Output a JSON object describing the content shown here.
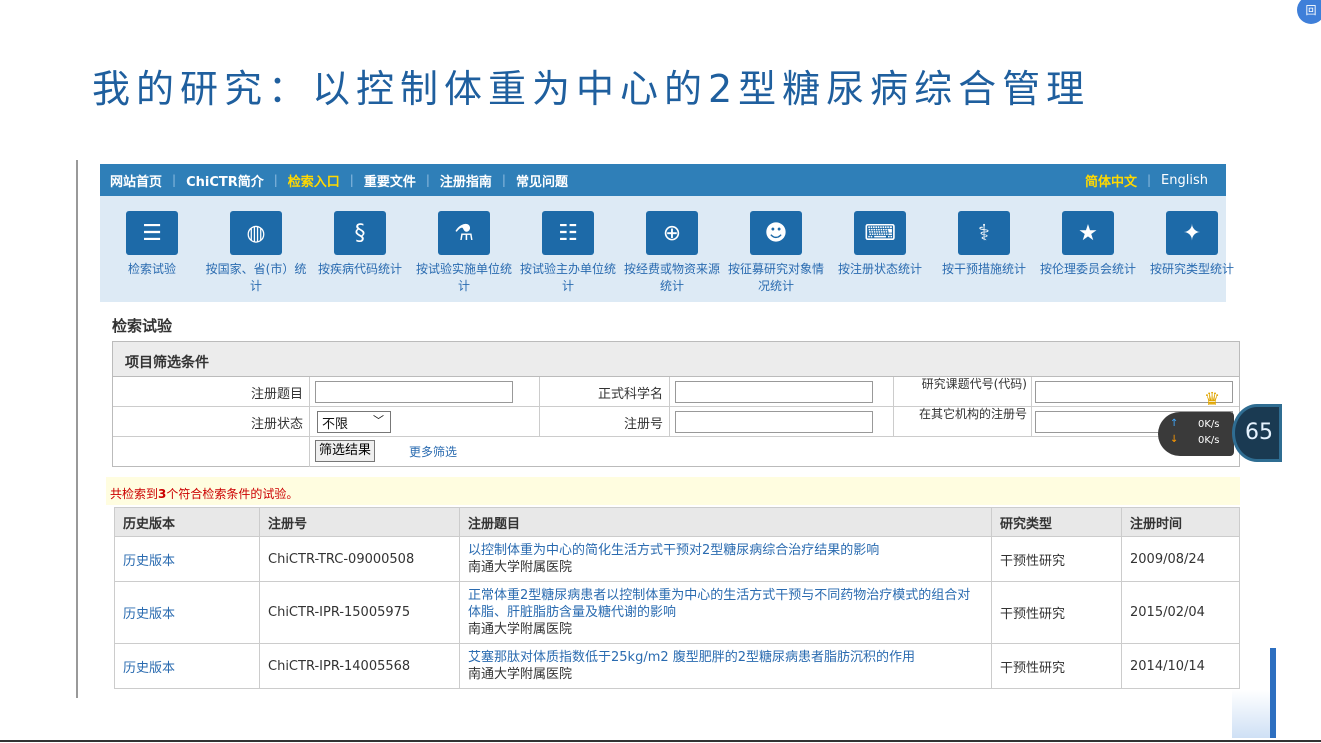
{
  "slide": {
    "title": "我的研究：以控制体重为中心的2型糖尿病综合管理",
    "corner_icon_text": "回"
  },
  "nav": {
    "items": [
      "网站首页",
      "ChiCTR简介",
      "检索入口",
      "重要文件",
      "注册指南",
      "常见问题"
    ],
    "active_index": 2,
    "lang_cn": "简体中文",
    "lang_en": "English"
  },
  "iconbar": {
    "items": [
      {
        "label": "检索试验",
        "icon": "list-icon"
      },
      {
        "label": "按国家、省(市）统计",
        "icon": "world-map-icon"
      },
      {
        "label": "按疾病代码统计",
        "icon": "dna-icon"
      },
      {
        "label": "按试验实施单位统计",
        "icon": "flask-icon"
      },
      {
        "label": "按试验主办单位统计",
        "icon": "clipboard-icon"
      },
      {
        "label": "按经费或物资来源统计",
        "icon": "medkit-icon"
      },
      {
        "label": "按征募研究对象情况统计",
        "icon": "people-icon"
      },
      {
        "label": "按注册状态统计",
        "icon": "keyboard-icon"
      },
      {
        "label": "按干预措施统计",
        "icon": "stethoscope-icon"
      },
      {
        "label": "按伦理委员会统计",
        "icon": "star-icon"
      },
      {
        "label": "按研究类型统计",
        "icon": "sparkle-icon"
      }
    ]
  },
  "search": {
    "section_title": "检索试验",
    "filter_title": "项目筛选条件",
    "labels": {
      "reg_title": "注册题目",
      "sci_name": "正式科学名",
      "subject_code": "研究课题代号(代码)",
      "reg_status": "注册状态",
      "reg_no": "注册号",
      "other_reg": "在其它机构的注册号"
    },
    "status_value": "不限",
    "filter_button": "筛选结果",
    "more_filter": "更多筛选"
  },
  "result": {
    "prefix": "共检索到",
    "count": "3",
    "suffix": "个符合检索条件的试验。"
  },
  "table": {
    "headers": [
      "历史版本",
      "注册号",
      "注册题目",
      "研究类型",
      "注册时间"
    ],
    "rows": [
      {
        "history": "历史版本",
        "reg_no": "ChiCTR-TRC-09000508",
        "title": "以控制体重为中心的简化生活方式干预对2型糖尿病综合治疗结果的影响",
        "institution": "南通大学附属医院",
        "type": "干预性研究",
        "date": "2009/08/24"
      },
      {
        "history": "历史版本",
        "reg_no": "ChiCTR-IPR-15005975",
        "title": "正常体重2型糖尿病患者以控制体重为中心的生活方式干预与不同药物治疗模式的组合对体脂、肝脏脂肪含量及糖代谢的影响",
        "institution": "南通大学附属医院",
        "type": "干预性研究",
        "date": "2015/02/04"
      },
      {
        "history": "历史版本",
        "reg_no": "ChiCTR-IPR-14005568",
        "title": "艾塞那肽对体质指数低于25kg/m2 腹型肥胖的2型糖尿病患者脂肪沉积的作用",
        "institution": "南通大学附属医院",
        "type": "干预性研究",
        "date": "2014/10/14"
      }
    ]
  },
  "overlay": {
    "up_speed": "0K/s",
    "down_speed": "0K/s",
    "percent": "65"
  }
}
